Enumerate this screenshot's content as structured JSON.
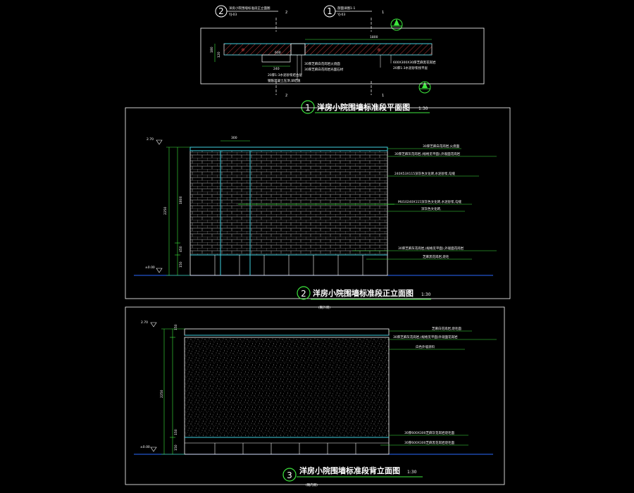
{
  "colors": {
    "background": "#000000",
    "line": "#ffffff",
    "dim": "#3ee83e",
    "hatch": "#d04040",
    "cyan": "#3fd0e0"
  },
  "callouts": [
    {
      "num": "2",
      "line1": "洋房小院围墙标准段正立面图",
      "line2": "YJ-03",
      "axis": "2"
    },
    {
      "num": "1",
      "line1": "剖面详图1-1",
      "line2": "YJ-03",
      "axis": "1"
    }
  ],
  "plan": {
    "axis_bottom_left": "2",
    "axis_bottom_right": "1",
    "dims": {
      "left_a": "180",
      "left_b": "120",
      "mid": "600",
      "mid2": "240",
      "right": "1800"
    },
    "notes": [
      "30厚芝麻白花岗岩火烧面",
      "30厚芝麻白花岗岩光面石材",
      "20厚1:3水泥砂浆结合层",
      "钢筋混凝土压顶,详结施",
      "600X300X30厚芝麻黑花岗岩",
      "20厚1:3水泥砂浆找平层"
    ]
  },
  "titles": [
    {
      "num": "1",
      "text": "洋房小院围墙标准段平面图",
      "scale": "1:30"
    },
    {
      "num": "2",
      "text": "洋房小院围墙标准段正立面图",
      "scale": "1:30",
      "sub": "(朝外侧)"
    },
    {
      "num": "3",
      "text": "洋房小院围墙标准段背立面图",
      "scale": "1:30",
      "sub": "(朝内侧)"
    }
  ],
  "front": {
    "level_top": "2.70",
    "level_ground": "±0.00",
    "dim_top": "300",
    "dims_vertical": [
      "2250",
      "1800",
      "450",
      "150"
    ],
    "notes": [
      "30厚芝麻白花岗岩,火烧面",
      "30厚芝麻灰花岗岩,(规格见平面),外观面花岗岩",
      "240X53X115深灰色文化砖,水泥砂浆,勾缝",
      "MU10240X115深灰色文化砖,水泥砂浆,勾缝",
      "深灰色文化砖,",
      "30厚芝麻灰花岗岩,(规格见平面),外观面花岗岩",
      "芝麻黑花岗岩,烧毛"
    ]
  },
  "back": {
    "level_top": "2.70",
    "level_ground": "±0.00",
    "dims_vertical": [
      "150",
      "2250",
      "150",
      "150"
    ],
    "notes": [
      "芝麻白花岗岩,烧毛面",
      "30厚芝麻灰花岗岩,(规格见平面)外观面花岗岩",
      "白色外墙涂料",
      "30厚600X300芝麻灰花岗岩烧毛面",
      "30厚600X300芝麻黑花岗岩烧毛面"
    ]
  }
}
